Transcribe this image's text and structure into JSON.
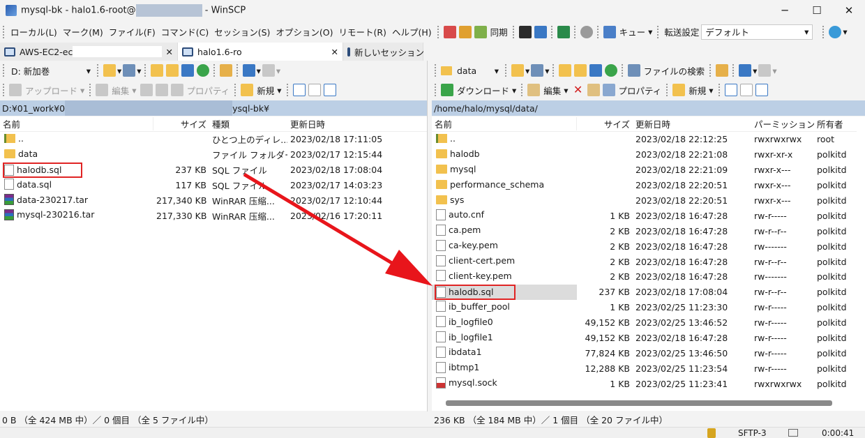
{
  "window": {
    "title_prefix": "mysql-bk - halo1.6-root@",
    "title_suffix": " - WinSCP",
    "minimize": "─",
    "maximize": "☐",
    "close": "✕"
  },
  "menu": [
    "ローカル(L)",
    "マーク(M)",
    "ファイル(F)",
    "コマンド(C)",
    "セッション(S)",
    "オプション(O)",
    "リモート(R)",
    "ヘルプ(H)"
  ],
  "toolbar": {
    "sync_label": "同期",
    "queue_label": "キュー",
    "transfer_label": "転送設定",
    "transfer_value": "デフォルト"
  },
  "tabs": [
    {
      "label": "AWS-EC2-ec"
    },
    {
      "label": "halo1.6-ro"
    },
    {
      "label": "新しいセッション"
    }
  ],
  "left": {
    "drive": "D: 新加巻",
    "upload": "アップロード",
    "edit": "編集",
    "properties": "プロパティ",
    "new": "新規",
    "path_a": "D:¥01_work¥0",
    "path_b": "ysql-bk¥",
    "columns": [
      "名前",
      "サイズ",
      "種類",
      "更新日時"
    ],
    "files": [
      {
        "name": "..",
        "size": "",
        "type": "ひとつ上のディレ...",
        "date": "2023/02/18  17:11:05",
        "icon": "up"
      },
      {
        "name": "data",
        "size": "",
        "type": "ファイル フォルダー",
        "date": "2023/02/17  12:15:44",
        "icon": "folder"
      },
      {
        "name": "halodb.sql",
        "size": "237 KB",
        "type": "SQL ファイル",
        "date": "2023/02/18  17:08:04",
        "icon": "doc",
        "highlight": true
      },
      {
        "name": "data.sql",
        "size": "117 KB",
        "type": "SQL ファイル",
        "date": "2023/02/17  14:03:23",
        "icon": "doc"
      },
      {
        "name": "data-230217.tar",
        "size": "217,340 KB",
        "type": "WinRAR 压缩...",
        "date": "2023/02/17  12:10:44",
        "icon": "rar"
      },
      {
        "name": "mysql-230216.tar",
        "size": "217,330 KB",
        "type": "WinRAR 压缩...",
        "date": "2023/02/16  17:20:11",
        "icon": "rar"
      }
    ],
    "status": "0 B （全 424 MB 中）／ 0 個目 （全 5 ファイル中）"
  },
  "right": {
    "dir": "data",
    "search": "ファイルの検索",
    "download": "ダウンロード",
    "edit": "編集",
    "properties": "プロパティ",
    "new": "新規",
    "path": "/home/halo/mysql/data/",
    "columns": [
      "名前",
      "サイズ",
      "更新日時",
      "パーミッション",
      "所有者"
    ],
    "files": [
      {
        "name": "..",
        "size": "",
        "date": "2023/02/18 22:12:25",
        "perm": "rwxrwxrwx",
        "owner": "root",
        "icon": "up"
      },
      {
        "name": "halodb",
        "size": "",
        "date": "2023/02/18 22:21:08",
        "perm": "rwxr-xr-x",
        "owner": "polkitd",
        "icon": "folder"
      },
      {
        "name": "mysql",
        "size": "",
        "date": "2023/02/18 22:21:09",
        "perm": "rwxr-x---",
        "owner": "polkitd",
        "icon": "folder"
      },
      {
        "name": "performance_schema",
        "size": "",
        "date": "2023/02/18 22:20:51",
        "perm": "rwxr-x---",
        "owner": "polkitd",
        "icon": "folder"
      },
      {
        "name": "sys",
        "size": "",
        "date": "2023/02/18 22:20:51",
        "perm": "rwxr-x---",
        "owner": "polkitd",
        "icon": "folder"
      },
      {
        "name": "auto.cnf",
        "size": "1 KB",
        "date": "2023/02/18 16:47:28",
        "perm": "rw-r-----",
        "owner": "polkitd",
        "icon": "doc"
      },
      {
        "name": "ca.pem",
        "size": "2 KB",
        "date": "2023/02/18 16:47:28",
        "perm": "rw-r--r--",
        "owner": "polkitd",
        "icon": "doc"
      },
      {
        "name": "ca-key.pem",
        "size": "2 KB",
        "date": "2023/02/18 16:47:28",
        "perm": "rw-------",
        "owner": "polkitd",
        "icon": "doc"
      },
      {
        "name": "client-cert.pem",
        "size": "2 KB",
        "date": "2023/02/18 16:47:28",
        "perm": "rw-r--r--",
        "owner": "polkitd",
        "icon": "doc"
      },
      {
        "name": "client-key.pem",
        "size": "2 KB",
        "date": "2023/02/18 16:47:28",
        "perm": "rw-------",
        "owner": "polkitd",
        "icon": "doc"
      },
      {
        "name": "halodb.sql",
        "size": "237 KB",
        "date": "2023/02/18 17:08:04",
        "perm": "rw-r--r--",
        "owner": "polkitd",
        "icon": "doc",
        "highlight": true
      },
      {
        "name": "ib_buffer_pool",
        "size": "1 KB",
        "date": "2023/02/25 11:23:30",
        "perm": "rw-r-----",
        "owner": "polkitd",
        "icon": "doc"
      },
      {
        "name": "ib_logfile0",
        "size": "49,152 KB",
        "date": "2023/02/25 13:46:52",
        "perm": "rw-r-----",
        "owner": "polkitd",
        "icon": "doc"
      },
      {
        "name": "ib_logfile1",
        "size": "49,152 KB",
        "date": "2023/02/18 16:47:28",
        "perm": "rw-r-----",
        "owner": "polkitd",
        "icon": "doc"
      },
      {
        "name": "ibdata1",
        "size": "77,824 KB",
        "date": "2023/02/25 13:46:50",
        "perm": "rw-r-----",
        "owner": "polkitd",
        "icon": "doc"
      },
      {
        "name": "ibtmp1",
        "size": "12,288 KB",
        "date": "2023/02/25 11:23:54",
        "perm": "rw-r-----",
        "owner": "polkitd",
        "icon": "doc"
      },
      {
        "name": "mysql.sock",
        "size": "1 KB",
        "date": "2023/02/25 11:23:41",
        "perm": "rwxrwxrwx",
        "owner": "polkitd",
        "icon": "sock"
      }
    ],
    "status": "236 KB （全 184 MB 中）／ 1 個目 （全 20 ファイル中）"
  },
  "statusbar": {
    "protocol": "SFTP-3",
    "timer": "0:00:41"
  },
  "colors": {
    "path_bg": "#bccfe5",
    "highlight": "#e02424",
    "arrow": "#e8151b"
  }
}
